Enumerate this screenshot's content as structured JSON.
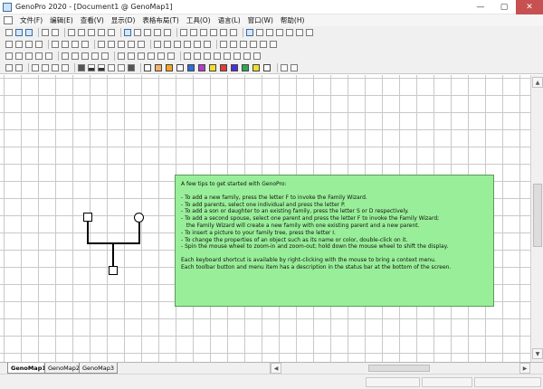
{
  "window": {
    "title": "GenoPro 2020 - [Document1 @ GenoMap1]",
    "controls": [
      "minimize-icon",
      "maximize-icon",
      "close-icon"
    ]
  },
  "menu": {
    "items": [
      "文件(F)",
      "编辑(E)",
      "查看(V)",
      "显示(D)",
      "表格布局(T)",
      "工具(O)",
      "语言(L)",
      "窗口(W)",
      "帮助(H)"
    ]
  },
  "tips": {
    "lines": [
      "A few tips to get started with GenoPro:",
      "",
      "- To add a new family, press the letter F to invoke the Family Wizard.",
      "- To add parents, select one individual and press the letter P.",
      "- To add a son or daughter to an existing family, press the letter S or D respectively.",
      "- To add a second spouse, select one parent and press the letter F to invoke the Family Wizard;",
      "   the Family Wizard will create a new family with one existing parent and a new parent.",
      "- To insert a picture to your family tree, press the letter I.",
      "- To change the properties of an object such as its name or color, double-click on it.",
      "- Spin the mouse wheel to zoom-in and zoom-out; hold down the mouse wheel to shift the display.",
      "",
      "Each keyboard shortcut is available by right-clicking with the mouse to bring a context menu.",
      "Each toolbar button and menu item has a description in the status bar at the bottom of the screen."
    ],
    "background": "#99ef99"
  },
  "tabs": [
    {
      "label": "GenoMap1",
      "active": true
    },
    {
      "label": "GenoMap2",
      "active": false
    },
    {
      "label": "GenoMap3",
      "active": false
    }
  ],
  "swatch_colors": [
    "#ffffff",
    "#f7b267",
    "#f5a623",
    "#ffffff",
    "#2f6fd6",
    "#b43cc8",
    "#f0e02a",
    "#e53b3b",
    "#4d2fd6",
    "#2fa84f",
    "#f0e02a",
    "#ffffff"
  ]
}
